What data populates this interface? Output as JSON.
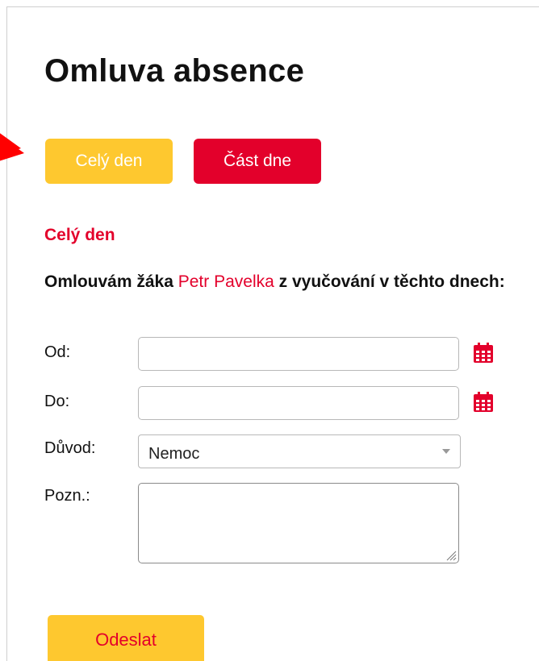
{
  "form": {
    "title": "Omluva absence",
    "mode_buttons": {
      "full_day": "Celý den",
      "part_day": "Část dne"
    },
    "section_title": "Celý den",
    "statement": {
      "prefix": "Omlouvám žáka ",
      "student_name": "Petr Pavelka",
      "suffix": " z vyučování v těchto dnech:"
    },
    "fields": {
      "from_label": "Od:",
      "from_value": "",
      "to_label": "Do:",
      "to_value": "",
      "reason_label": "Důvod:",
      "reason_value": "Nemoc",
      "note_label": "Pozn.:"
    },
    "submit_label": "Odeslat"
  },
  "colors": {
    "accent_yellow": "#fec82f",
    "accent_red": "#e3002b",
    "annotation_arrow": "#ff0000"
  },
  "icons": {
    "date_picker": "calendar-icon",
    "annotation": "arrow-annotation"
  }
}
